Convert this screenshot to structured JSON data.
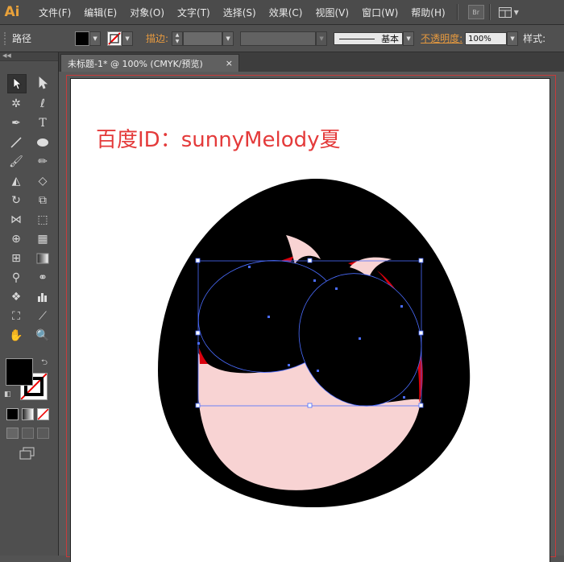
{
  "app": {
    "logo": "Ai"
  },
  "menu": [
    "文件(F)",
    "编辑(E)",
    "对象(O)",
    "文字(T)",
    "选择(S)",
    "效果(C)",
    "视图(V)",
    "窗口(W)",
    "帮助(H)"
  ],
  "menu_right": {
    "bridge_label": "Br"
  },
  "control": {
    "object_type": "路径",
    "stroke_label": "描边:",
    "profile_label": "基本",
    "opacity_label": "不透明度:",
    "opacity_value": "100%",
    "style_label": "样式:"
  },
  "document": {
    "tab_title": "未标题-1* @ 100% (CMYK/预览)",
    "close_glyph": "×"
  },
  "artboard": {
    "watermark": "百度ID：sunnyMelody夏"
  },
  "colors": {
    "accent_orange": "#e79a3f",
    "watermark_red": "#e43a3a",
    "selection_blue": "#4a6cff",
    "pink_fill": "#f8d3d3",
    "red_fill": "#d9000e"
  },
  "tools": [
    "selection-tool",
    "direct-selection-tool",
    "magic-wand-tool",
    "lasso-tool",
    "pen-tool",
    "type-tool",
    "line-segment-tool",
    "ellipse-tool",
    "paintbrush-tool",
    "pencil-tool",
    "blob-brush-tool",
    "eraser-tool",
    "rotate-tool",
    "scale-tool",
    "width-tool",
    "free-transform-tool",
    "shape-builder-tool",
    "perspective-grid-tool",
    "mesh-tool",
    "gradient-tool",
    "eyedropper-tool",
    "blend-tool",
    "symbol-sprayer-tool",
    "column-graph-tool",
    "artboard-tool",
    "slice-tool",
    "hand-tool",
    "zoom-tool"
  ]
}
